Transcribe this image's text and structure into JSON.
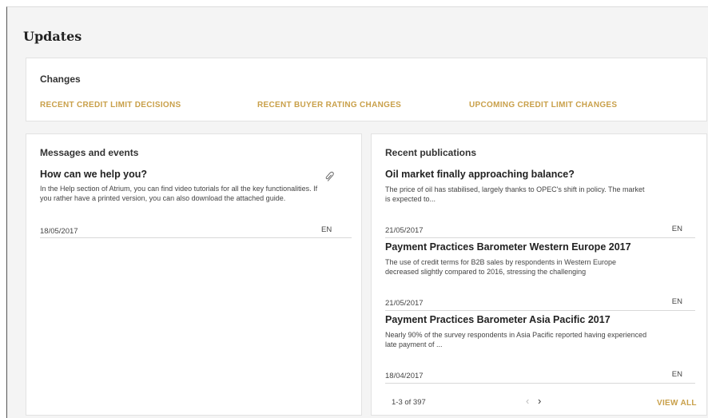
{
  "page": {
    "title": "Updates"
  },
  "changes": {
    "heading": "Changes",
    "links": [
      "RECENT CREDIT LIMIT DECISIONS",
      "RECENT BUYER RATING CHANGES",
      "UPCOMING CREDIT LIMIT CHANGES"
    ]
  },
  "messages": {
    "heading": "Messages and events",
    "items": [
      {
        "title": "How can we help you?",
        "body": "In the Help section of Atrium, you can find video tutorials for all the key functionalities. If you rather have a printed version, you can also download the attached guide.",
        "date": "18/05/2017",
        "lang": "EN",
        "icon": "paperclip-icon"
      }
    ]
  },
  "publications": {
    "heading": "Recent publications",
    "items": [
      {
        "title": "Oil market finally approaching balance?",
        "body": "The price of oil has stabilised, largely thanks to OPEC's shift in policy. The market is expected to...",
        "date": "21/05/2017",
        "lang": "EN"
      },
      {
        "title": "Payment Practices Barometer Western Europe 2017",
        "body": "The use of credit terms for B2B sales by respondents in Western Europe decreased slightly compared to 2016, stressing the challenging",
        "date": "21/05/2017",
        "lang": "EN"
      },
      {
        "title": "Payment Practices Barometer Asia Pacific 2017",
        "body": "Nearly 90% of the survey respondents in Asia Pacific reported having experienced late payment of ...",
        "date": "18/04/2017",
        "lang": "EN"
      }
    ],
    "pager": {
      "count": "1-3 of 397",
      "prev": "‹",
      "next": "›"
    },
    "view_all": "VIEW ALL"
  },
  "colors": {
    "accent": "#c9a04a",
    "background": "#f4f4f4",
    "card": "#ffffff"
  }
}
